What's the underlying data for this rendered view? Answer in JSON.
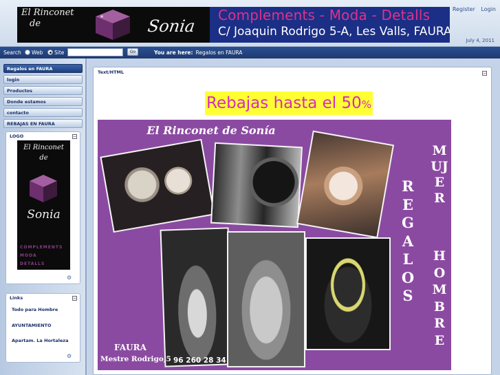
{
  "colors": {
    "accent": "#1e3a6f",
    "poster_bg": "#8b4aa1",
    "sale_highlight": "#ffff33",
    "sale_text": "#d12ebf",
    "banner_pink": "#e0318b"
  },
  "header": {
    "banner": {
      "script_line1": "El Rinconet",
      "script_line2": "de",
      "name": "Sonia",
      "line1": "Complements - Moda - Detalls",
      "line2": "C/ Joaquin Rodrigo 5-A, Les Valls, FAURA"
    },
    "register_label": "Register",
    "login_label": "Login",
    "date": "July 4, 2011"
  },
  "search": {
    "label": "Search",
    "option_web": "Web",
    "option_site": "Site",
    "selected": "Site",
    "value": "",
    "go_label": "Go"
  },
  "breadcrumb": {
    "prefix": "You are here:",
    "current": "Regalos en FAURA"
  },
  "nav": {
    "items": [
      {
        "label": "Regalos en FAURA",
        "active": true
      },
      {
        "label": "login"
      },
      {
        "label": "Productos"
      },
      {
        "label": "Donde estamos"
      },
      {
        "label": "contacto"
      },
      {
        "label": "REBAJAS EN FAURA"
      }
    ]
  },
  "logo_panel": {
    "title": "LOGO",
    "collapse": "−",
    "logo": {
      "line1": "El Rinconet",
      "line2": "de",
      "name": "Sonia",
      "tags": [
        "COMPLEMENTS",
        "MODA",
        "DETALLS"
      ]
    }
  },
  "links_panel": {
    "title": "Links",
    "collapse": "−",
    "items": [
      "Todo para Hombre",
      "AYUNTAMIENTO",
      "Apartam. La Hortaleza"
    ]
  },
  "main": {
    "panel_title": "Text/HTML",
    "collapse": "−",
    "sale_text": "Rebajas hasta el 50",
    "sale_pct": "%",
    "poster": {
      "title": "El Rinconet de Sonía",
      "regalos": "REGALOS",
      "mujer": "MUJER",
      "hombre": "HOMBRE",
      "place": "FAURA",
      "street": "Mestre Rodrigo,5",
      "phone": "96 260 28 34"
    }
  },
  "icons": [
    "cube-logo-icon",
    "radio-icon",
    "collapse-icon",
    "edit-settings-icon"
  ]
}
